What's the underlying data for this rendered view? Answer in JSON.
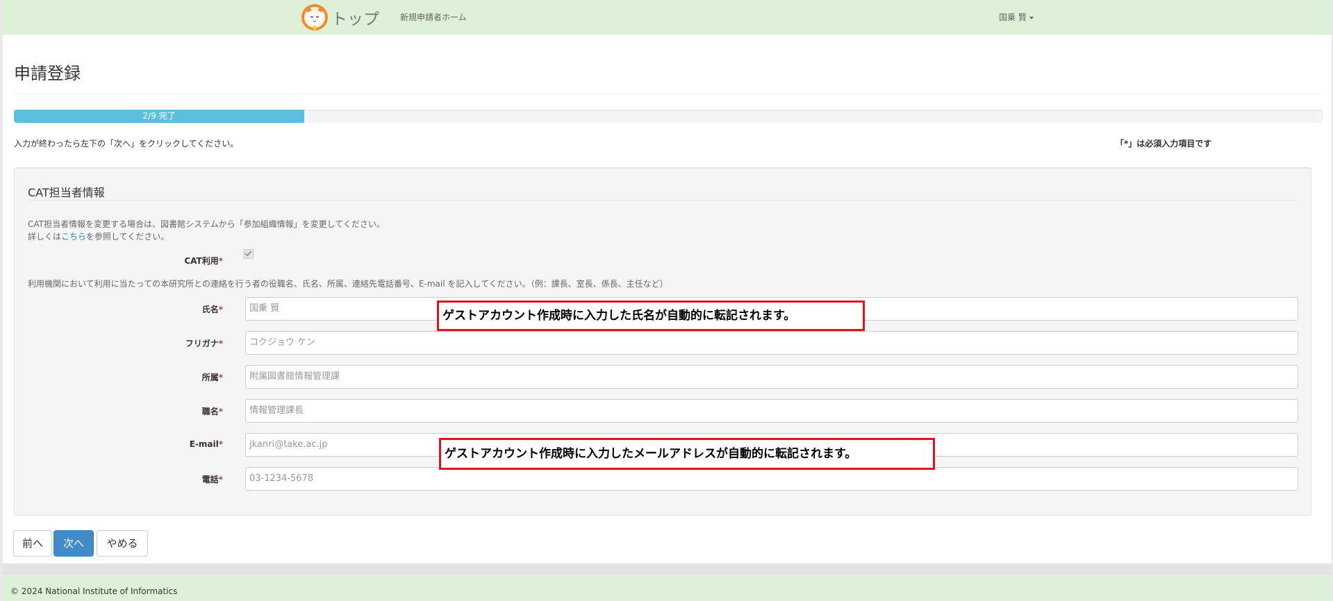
{
  "navbar": {
    "brand_label": "トップ",
    "home_link": "新規申請者ホーム",
    "user_name": "国乗 賢"
  },
  "page": {
    "title": "申請登録",
    "progress_label": "2/9 完了",
    "progress_fraction": 0.222,
    "instruction": "入力が終わったら左下の「次へ」をクリックしてください。",
    "required_note": "「*」は必須入力項目です"
  },
  "section": {
    "legend": "CAT担当者情報",
    "help_line1": "CAT担当者情報を変更する場合は、図書館システムから「参加組織情報」を変更してください。",
    "help_line2_prefix": "詳しくは",
    "help_line2_link": "こちら",
    "help_line2_suffix": "を参照してください。",
    "cat_label": "CAT利用",
    "cat_checked": true,
    "help_line3": "利用機関において利用に当たっての本研究所との連絡を行う者の役職名、氏名、所属、連絡先電話番号、E-mail を記入してください。（例：課長、室長、係長、主任など）",
    "required_mark": "*"
  },
  "fields": {
    "name": {
      "label": "氏名",
      "value": "国乗 賢"
    },
    "furigana": {
      "label": "フリガナ",
      "value": "コクジョウ ケン"
    },
    "affiliation": {
      "label": "所属",
      "value": "附属図書館情報管理課"
    },
    "position": {
      "label": "職名",
      "value": "情報管理課長"
    },
    "email": {
      "label": "E-mail",
      "value": "jkanri@take.ac.jp"
    },
    "phone": {
      "label": "電話",
      "value": "03-1234-5678"
    }
  },
  "callouts": {
    "name_note": "ゲストアカウント作成時に入力した氏名が自動的に転記されます。",
    "email_note": "ゲストアカウント作成時に入力したメールアドレスが自動的に転記されます。"
  },
  "buttons": {
    "prev": "前へ",
    "next": "次へ",
    "cancel": "やめる"
  },
  "footer": {
    "copyright": "© 2024 National Institute of Informatics"
  },
  "colors": {
    "navbar_bg": "#dff0d8",
    "progress": "#5bc0de",
    "primary": "#428bca",
    "callout_border": "#e0141e"
  }
}
